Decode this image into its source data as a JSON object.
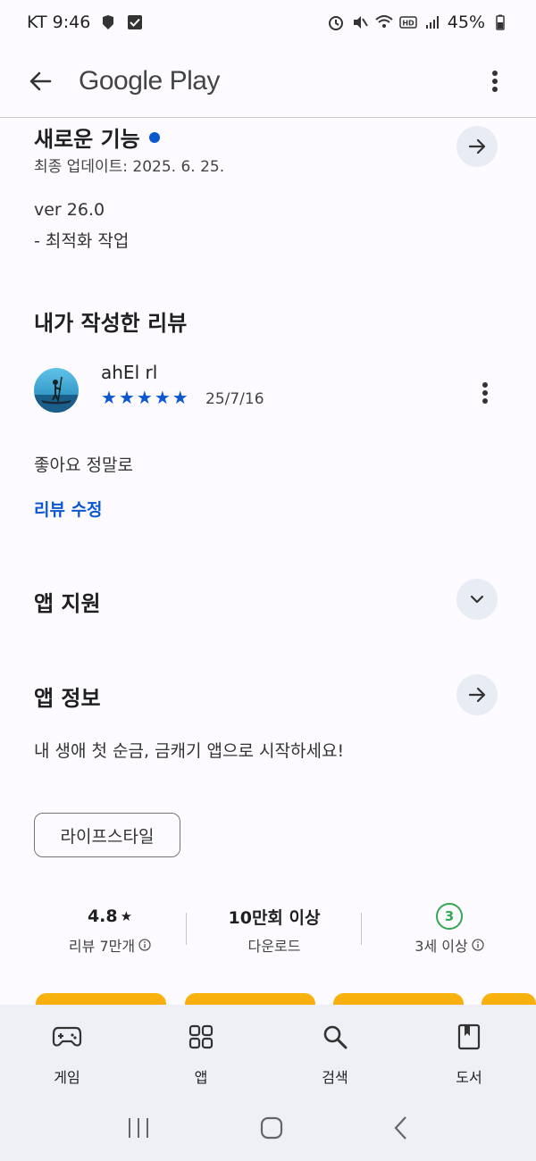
{
  "status_bar": {
    "carrier_time": "KT 9:46",
    "battery": "45%"
  },
  "app_bar": {
    "title": "Google Play"
  },
  "whats_new": {
    "title": "새로운 기능",
    "last_updated": "최종 업데이트: 2025. 6. 25.",
    "version": "ver 26.0",
    "note": "- 최적화 작업"
  },
  "my_review": {
    "title": "내가 작성한 리뷰",
    "reviewer": "ahEl rl",
    "rating": 5,
    "date": "25/7/16",
    "text": "좋아요 정말로",
    "edit_label": "리뷰 수정"
  },
  "app_support": {
    "title": "앱 지원"
  },
  "app_info": {
    "title": "앱 정보",
    "description": "내 생애 첫 순금, 금캐기 앱으로 시작하세요!",
    "category_chip": "라이프스타일"
  },
  "stats": {
    "rating_value": "4.8",
    "rating_label": "리뷰 7만개",
    "downloads_value": "10만회 이상",
    "downloads_label": "다운로드",
    "age_badge": "3",
    "age_label": "3세 이상"
  },
  "bottom_nav": [
    {
      "label": "게임",
      "icon": "gamepad-icon"
    },
    {
      "label": "앱",
      "icon": "apps-grid-icon"
    },
    {
      "label": "검색",
      "icon": "search-icon"
    },
    {
      "label": "도서",
      "icon": "book-icon"
    }
  ],
  "colors": {
    "accent": "#0b57d0",
    "age_green": "#34a853",
    "card_orange": "#f4a000"
  }
}
